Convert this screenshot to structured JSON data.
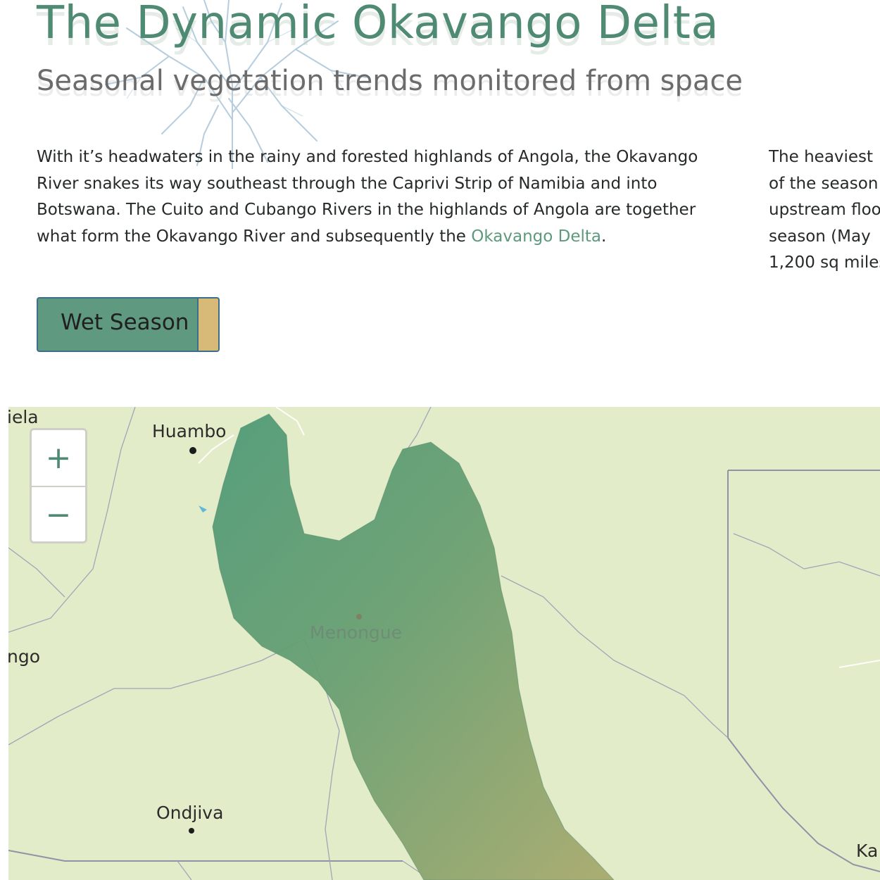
{
  "header": {
    "title": "The Dynamic Okavango Delta",
    "subtitle": "Seasonal vegetation trends monitored from space"
  },
  "intro": {
    "text_before_link": "With it’s headwaters in the rainy and forested highlands of Angola, the Okavango River snakes its way southeast through the Caprivi Strip of Namibia and into Botswana. The Cuito and Cubango Rivers in the highlands of Angola are together what form the Okavango River and subsequently the ",
    "link_text": "Okavango Delta",
    "text_after_link": "."
  },
  "intro_right": {
    "lines": [
      "The heaviest",
      "of the season",
      "upstream floo",
      "season (May",
      "1,200 sq miles"
    ]
  },
  "toggle": {
    "label": "Wet Season"
  },
  "map": {
    "zoom_in": "+",
    "zoom_out": "−",
    "places": {
      "huambo": "Huambo",
      "ondjiva": "Ondjiva",
      "menongue": "Menongue",
      "edge_left_top": "iela",
      "edge_left_mid": "ngo",
      "edge_right_bottom": "Ka"
    }
  },
  "colors": {
    "accent": "#4f8a72",
    "link": "#5c9a7e",
    "toggle_bg": "#5f9a80",
    "toggle_knob": "#d7b978",
    "map_land": "#e3ecc8",
    "basin_green": "#5f9a78"
  }
}
